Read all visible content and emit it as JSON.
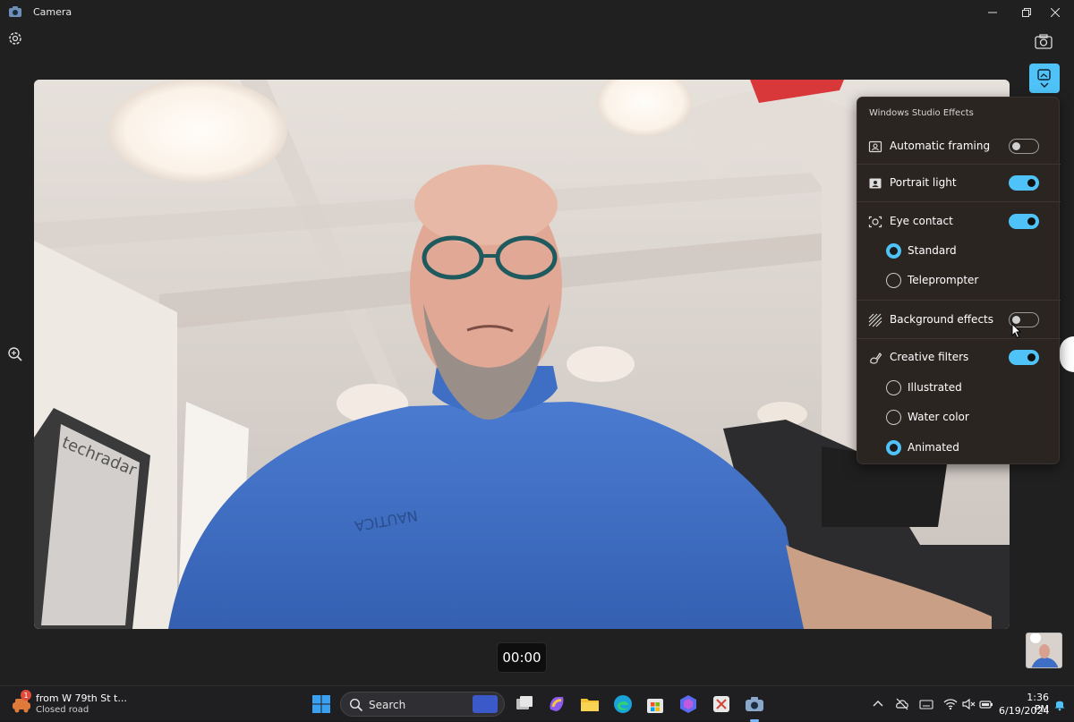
{
  "window": {
    "title": "Camera"
  },
  "viewer": {
    "timer": "00:00"
  },
  "effects_panel": {
    "title": "Windows Studio Effects",
    "automatic_framing": {
      "label": "Automatic framing",
      "enabled": false
    },
    "portrait_light": {
      "label": "Portrait light",
      "enabled": true
    },
    "eye_contact": {
      "label": "Eye contact",
      "enabled": true,
      "options": [
        "Standard",
        "Teleprompter"
      ],
      "selected": "Standard"
    },
    "background_effects": {
      "label": "Background effects",
      "enabled": false
    },
    "creative_filters": {
      "label": "Creative filters",
      "enabled": true,
      "options": [
        "Illustrated",
        "Water color",
        "Animated"
      ],
      "selected": "Animated"
    }
  },
  "taskbar": {
    "weather_badge": "1",
    "weather_line1": "from W 79th St t...",
    "weather_line2": "Closed road",
    "search_label": "Search",
    "time": "1:36 PM",
    "date": "6/19/2024"
  },
  "colors": {
    "accent": "#4fc3f7",
    "panel_bg": "#2b2522",
    "app_bg": "#202020"
  }
}
